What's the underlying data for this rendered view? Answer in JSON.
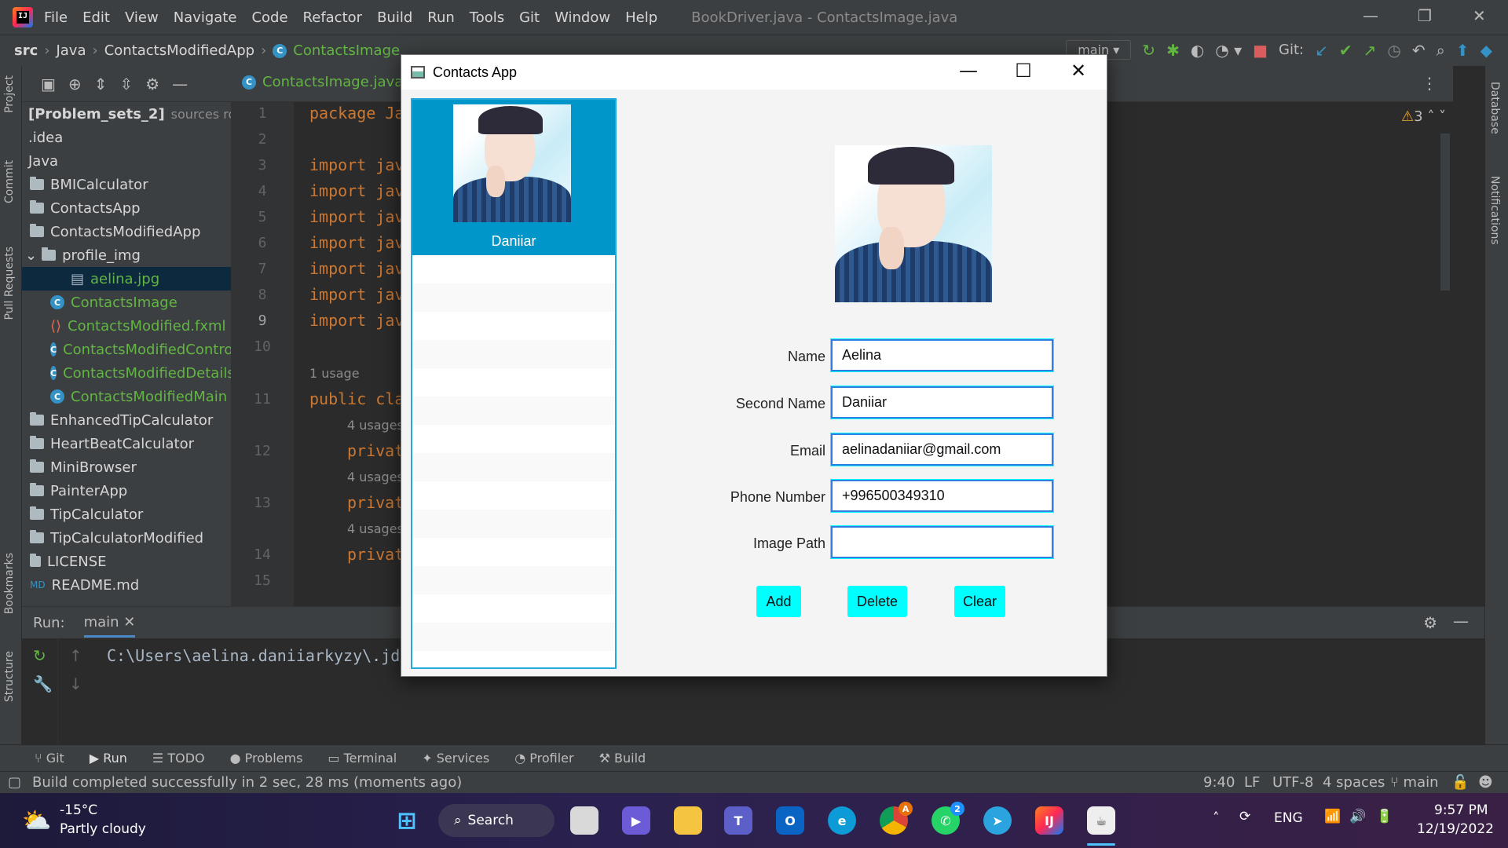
{
  "ide": {
    "menu": [
      "File",
      "Edit",
      "View",
      "Navigate",
      "Code",
      "Refactor",
      "Build",
      "Run",
      "Tools",
      "Git",
      "Window",
      "Help"
    ],
    "window_title": "BookDriver.java - ContactsImage.java",
    "breadcrumbs": [
      "src",
      "Java",
      "ContactsModifiedApp",
      "ContactsImage"
    ],
    "branch_button": "main",
    "git_label": "Git:",
    "left_strip": [
      "Project",
      "Commit",
      "Pull Requests",
      "Bookmarks",
      "Structure"
    ],
    "right_strip": [
      "Database",
      "Notifications"
    ],
    "project_tree": [
      {
        "label": "[Problem_sets_2]",
        "suffix": "sources root,"
      },
      {
        "label": ".idea"
      },
      {
        "label": "Java"
      },
      {
        "label": "BMICalculator"
      },
      {
        "label": "ContactsApp"
      },
      {
        "label": "ContactsModifiedApp"
      },
      {
        "label": "profile_img"
      },
      {
        "label": "aelina.jpg"
      },
      {
        "label": "ContactsImage"
      },
      {
        "label": "ContactsModified.fxml"
      },
      {
        "label": "ContactsModifiedControll"
      },
      {
        "label": "ContactsModifiedDetails"
      },
      {
        "label": "ContactsModifiedMain"
      },
      {
        "label": "EnhancedTipCalculator"
      },
      {
        "label": "HeartBeatCalculator"
      },
      {
        "label": "MiniBrowser"
      },
      {
        "label": "PainterApp"
      },
      {
        "label": "TipCalculator"
      },
      {
        "label": "TipCalculatorModified"
      },
      {
        "label": "LICENSE"
      },
      {
        "label": "README.md"
      }
    ],
    "editor_tab": "ContactsImage.java",
    "warnings": "3",
    "line_numbers": [
      "1",
      "2",
      "3",
      "4",
      "5",
      "6",
      "7",
      "8",
      "9",
      "10",
      "11",
      "12",
      "13",
      "14",
      "15"
    ],
    "code": {
      "package": "package Ja",
      "import": "import jav",
      "usage": "1 usage",
      "public": "public cla",
      "usages": "4 usages",
      "private": "privat"
    },
    "run": {
      "label": "Run:",
      "tab": "main",
      "console": "C:\\Users\\aelina.daniiarkyzy\\.jd"
    },
    "tool_windows": [
      "Git",
      "Run",
      "TODO",
      "Problems",
      "Terminal",
      "Services",
      "Profiler",
      "Build"
    ],
    "status": {
      "message": "Build completed successfully in 2 sec, 28 ms (moments ago)",
      "position": "9:40",
      "line_sep": "LF",
      "encoding": "UTF-8",
      "indent": "4 spaces",
      "branch": "main"
    }
  },
  "app": {
    "title": "Contacts App",
    "list_selected_name": "Daniiar",
    "form": {
      "name_label": "Name",
      "name_value": "Aelina",
      "second_label": "Second Name",
      "second_value": "Daniiar",
      "email_label": "Email",
      "email_value": "aelinadaniiar@gmail.com",
      "phone_label": "Phone Number",
      "phone_value": "+996500349310",
      "image_label": "Image Path",
      "image_value": ""
    },
    "buttons": {
      "add": "Add",
      "delete": "Delete",
      "clear": "Clear"
    },
    "accent": "#00ffff",
    "selection": "#0096c9"
  },
  "taskbar": {
    "weather_temp": "-15°C",
    "weather_desc": "Partly cloudy",
    "search": "Search",
    "language": "ENG",
    "time": "9:57 PM",
    "date": "12/19/2022",
    "badge_chrome": "A",
    "badge_whatsapp": "2"
  }
}
